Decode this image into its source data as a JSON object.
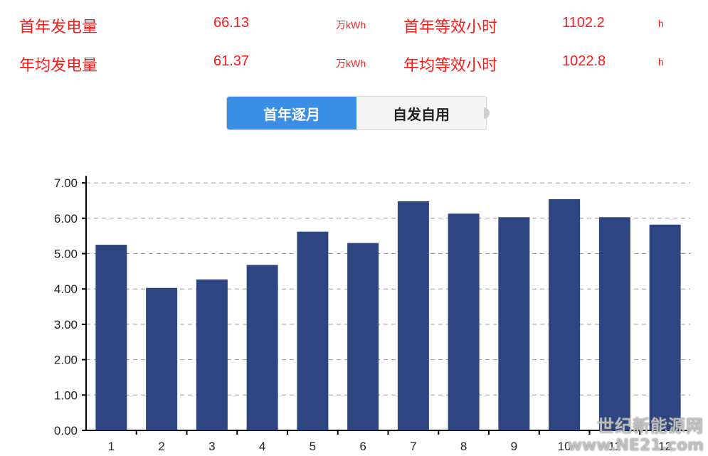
{
  "stats": [
    {
      "label": "首年发电量",
      "value": "66.13",
      "unit": "万kWh",
      "label2": "首年等效小时",
      "value2": "1102.2",
      "unit2": "h"
    },
    {
      "label": "年均发电量",
      "value": "61.37",
      "unit": "万kWh",
      "label2": "年均等效小时",
      "value2": "1022.8",
      "unit2": "h"
    }
  ],
  "tabs": {
    "active": "首年逐月",
    "inactive": "自发自用"
  },
  "colors": {
    "stat_text": "#ff1a1a",
    "bar": "#2d4580",
    "tab_active": "#3a8ee6",
    "grid": "#9a9a9a"
  },
  "chart_data": {
    "type": "bar",
    "categories": [
      "1",
      "2",
      "3",
      "4",
      "5",
      "6",
      "7",
      "8",
      "9",
      "10",
      "11",
      "12"
    ],
    "values": [
      5.25,
      4.03,
      4.27,
      4.68,
      5.62,
      5.3,
      6.48,
      6.13,
      6.03,
      6.54,
      6.03,
      5.82
    ],
    "yticks": [
      "0.00",
      "1.00",
      "2.00",
      "3.00",
      "4.00",
      "5.00",
      "6.00",
      "7.00"
    ],
    "ylim": [
      0,
      7.2
    ],
    "grid": "dashed-horizontal",
    "title": "",
    "xlabel": "",
    "ylabel": ""
  },
  "watermark": {
    "line1": "世纪新能源网",
    "line2": "www.NE21.com"
  }
}
